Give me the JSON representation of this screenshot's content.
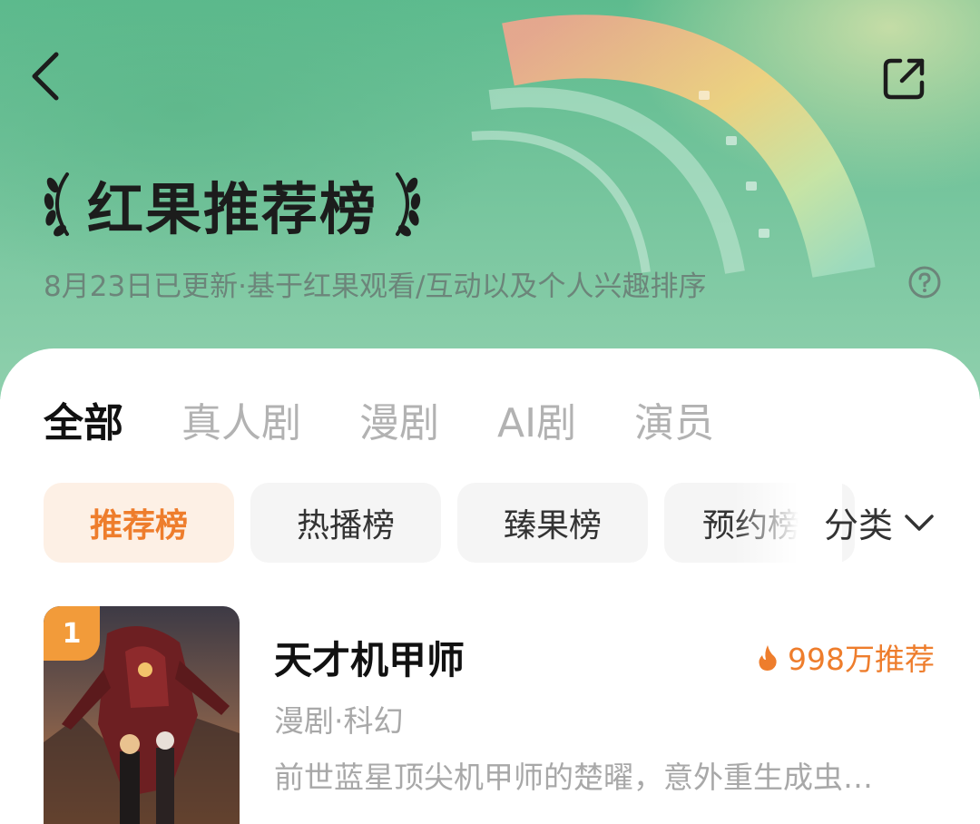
{
  "header": {
    "title": "红果推荐榜",
    "subtitle": "8月23日已更新·基于红果观看/互动以及个人兴趣排序"
  },
  "tabs": [
    "全部",
    "真人剧",
    "漫剧",
    "AI剧",
    "演员"
  ],
  "chips": [
    "推荐榜",
    "热播榜",
    "臻果榜",
    "预约榜"
  ],
  "category_label": "分类",
  "list": [
    {
      "rank": "1",
      "title": "天才机甲师",
      "hot": "998万推荐",
      "tags": "漫剧·科幻",
      "desc": "前世蓝星顶尖机甲师的楚曜，意外重生成虫…"
    }
  ],
  "colors": {
    "accent": "#ee7d2c",
    "hero_green": "#6cc196",
    "chip_active_bg": "#fdf0e5",
    "rank_badge": "#f29b3a"
  },
  "icons": {
    "back": "chevron-left-icon",
    "share": "share-icon",
    "help": "question-circle-icon",
    "laurel": "laurel-icon",
    "fire": "fire-icon",
    "dropdown": "chevron-down-icon"
  }
}
